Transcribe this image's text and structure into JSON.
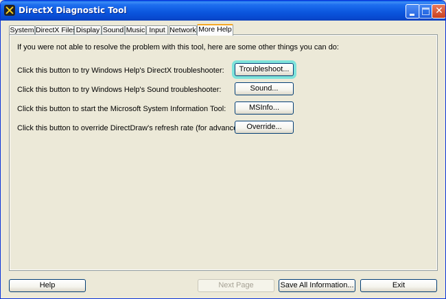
{
  "window": {
    "title": "DirectX Diagnostic Tool"
  },
  "tabs": [
    {
      "label": "System",
      "active": false
    },
    {
      "label": "DirectX Files",
      "active": false
    },
    {
      "label": "Display",
      "active": false
    },
    {
      "label": "Sound",
      "active": false
    },
    {
      "label": "Music",
      "active": false
    },
    {
      "label": "Input",
      "active": false
    },
    {
      "label": "Network",
      "active": false
    },
    {
      "label": "More Help",
      "active": true
    }
  ],
  "more_help": {
    "intro": "If you were not able to resolve the problem with this tool, here are some other things you can do:",
    "rows": [
      {
        "label": "Click this button to try Windows Help's DirectX troubleshooter:",
        "button": "Troubleshoot..."
      },
      {
        "label": "Click this button to try Windows Help's Sound troubleshooter:",
        "button": "Sound..."
      },
      {
        "label": "Click this button to start the Microsoft System Information Tool:",
        "button": "MSInfo..."
      },
      {
        "label": "Click this button to override DirectDraw's refresh rate (for advanced users only):",
        "button": "Override..."
      }
    ]
  },
  "footer": {
    "help": "Help",
    "next_page": "Next Page",
    "save_all": "Save All Information...",
    "exit": "Exit"
  },
  "colors": {
    "titlebar": "#0A55DD",
    "focus_highlight": "#7EE3DB",
    "active_tab_accent": "#F5A623"
  }
}
